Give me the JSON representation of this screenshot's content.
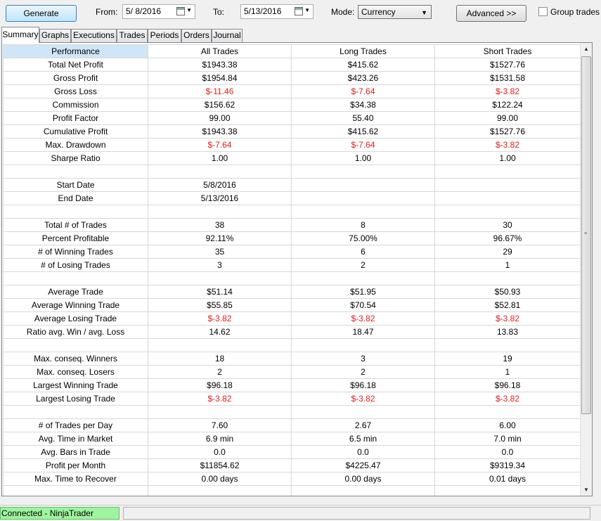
{
  "toolbar": {
    "generate_label": "Generate",
    "from_label": "From:",
    "from_value": "5/ 8/2016",
    "to_label": "To:",
    "to_value": "5/13/2016",
    "mode_label": "Mode:",
    "mode_value": "Currency",
    "advanced_label": "Advanced >>",
    "group_trades_label": "Group trades"
  },
  "tabs": [
    "Summary",
    "Graphs",
    "Executions",
    "Trades",
    "Periods",
    "Orders",
    "Journal"
  ],
  "table": {
    "headers": [
      "Performance",
      "All Trades",
      "Long Trades",
      "Short Trades"
    ],
    "rows": [
      {
        "label": "Total Net Profit",
        "all": "$1943.38",
        "long": "$415.62",
        "short": "$1527.76",
        "neg": false
      },
      {
        "label": "Gross Profit",
        "all": "$1954.84",
        "long": "$423.26",
        "short": "$1531.58",
        "neg": false
      },
      {
        "label": "Gross Loss",
        "all": "$-11.46",
        "long": "$-7.64",
        "short": "$-3.82",
        "neg": true
      },
      {
        "label": "Commission",
        "all": "$156.62",
        "long": "$34.38",
        "short": "$122.24",
        "neg": false
      },
      {
        "label": "Profit Factor",
        "all": "99.00",
        "long": "55.40",
        "short": "99.00",
        "neg": false
      },
      {
        "label": "Cumulative Profit",
        "all": "$1943.38",
        "long": "$415.62",
        "short": "$1527.76",
        "neg": false
      },
      {
        "label": "Max. Drawdown",
        "all": "$-7.64",
        "long": "$-7.64",
        "short": "$-3.82",
        "neg": true
      },
      {
        "label": "Sharpe Ratio",
        "all": "1.00",
        "long": "1.00",
        "short": "1.00",
        "neg": false
      },
      {
        "label": "",
        "all": "",
        "long": "",
        "short": "",
        "neg": false
      },
      {
        "label": "Start Date",
        "all": "5/8/2016",
        "long": "",
        "short": "",
        "neg": false
      },
      {
        "label": "End Date",
        "all": "5/13/2016",
        "long": "",
        "short": "",
        "neg": false
      },
      {
        "label": "",
        "all": "",
        "long": "",
        "short": "",
        "neg": false
      },
      {
        "label": "Total # of Trades",
        "all": "38",
        "long": "8",
        "short": "30",
        "neg": false
      },
      {
        "label": "Percent Profitable",
        "all": "92.11%",
        "long": "75.00%",
        "short": "96.67%",
        "neg": false
      },
      {
        "label": "# of Winning Trades",
        "all": "35",
        "long": "6",
        "short": "29",
        "neg": false
      },
      {
        "label": "# of Losing Trades",
        "all": "3",
        "long": "2",
        "short": "1",
        "neg": false
      },
      {
        "label": "",
        "all": "",
        "long": "",
        "short": "",
        "neg": false
      },
      {
        "label": "Average Trade",
        "all": "$51.14",
        "long": "$51.95",
        "short": "$50.93",
        "neg": false
      },
      {
        "label": "Average Winning Trade",
        "all": "$55.85",
        "long": "$70.54",
        "short": "$52.81",
        "neg": false
      },
      {
        "label": "Average Losing Trade",
        "all": "$-3.82",
        "long": "$-3.82",
        "short": "$-3.82",
        "neg": true
      },
      {
        "label": "Ratio avg. Win / avg. Loss",
        "all": "14.62",
        "long": "18.47",
        "short": "13.83",
        "neg": false
      },
      {
        "label": "",
        "all": "",
        "long": "",
        "short": "",
        "neg": false
      },
      {
        "label": "Max. conseq. Winners",
        "all": "18",
        "long": "3",
        "short": "19",
        "neg": false
      },
      {
        "label": "Max. conseq. Losers",
        "all": "2",
        "long": "2",
        "short": "1",
        "neg": false
      },
      {
        "label": "Largest Winning Trade",
        "all": "$96.18",
        "long": "$96.18",
        "short": "$96.18",
        "neg": false
      },
      {
        "label": "Largest Losing Trade",
        "all": "$-3.82",
        "long": "$-3.82",
        "short": "$-3.82",
        "neg": true
      },
      {
        "label": "",
        "all": "",
        "long": "",
        "short": "",
        "neg": false
      },
      {
        "label": "# of Trades per Day",
        "all": "7.60",
        "long": "2.67",
        "short": "6.00",
        "neg": false
      },
      {
        "label": "Avg. Time in Market",
        "all": "6.9 min",
        "long": "6.5 min",
        "short": "7.0 min",
        "neg": false
      },
      {
        "label": "Avg. Bars in Trade",
        "all": "0.0",
        "long": "0.0",
        "short": "0.0",
        "neg": false
      },
      {
        "label": "Profit per Month",
        "all": "$11854.62",
        "long": "$4225.47",
        "short": "$9319.34",
        "neg": false
      },
      {
        "label": "Max. Time to Recover",
        "all": "0.00 days",
        "long": "0.00 days",
        "short": "0.01 days",
        "neg": false
      },
      {
        "label": "",
        "all": "",
        "long": "",
        "short": "",
        "neg": false
      }
    ]
  },
  "status": {
    "connection": "Connected - NinjaTrader Continuum",
    "connection_color": "#9df59d"
  },
  "colors": {
    "negative": "#e0201c",
    "header_highlight": "#cfe6f8"
  }
}
